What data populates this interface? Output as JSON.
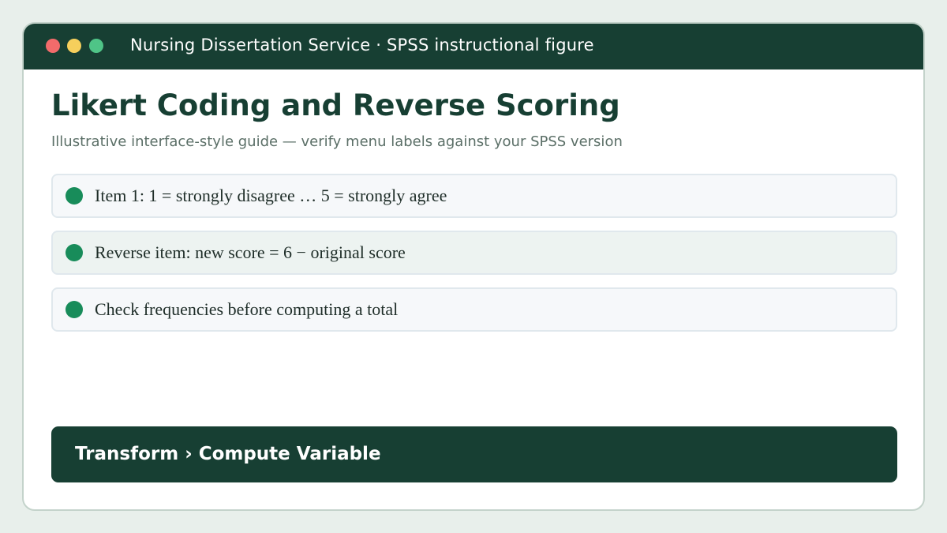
{
  "window": {
    "title": "Nursing Dissertation Service · SPSS instructional figure",
    "controls": [
      "close",
      "minimize",
      "maximize"
    ]
  },
  "main": {
    "title": "Likert Coding and Reverse Scoring",
    "subtitle": "Illustrative interface-style guide — verify menu labels against your SPSS version",
    "items": [
      {
        "text": "Item 1: 1 = strongly disagree … 5 = strongly agree"
      },
      {
        "text": "Reverse item: new score = 6 − original score"
      },
      {
        "text": "Check frequencies before computing a total"
      }
    ],
    "menu_path": "Transform › Compute Variable"
  },
  "colors": {
    "background": "#e8efeb",
    "header": "#173f33",
    "accent_dot": "#188c5a",
    "close_dot": "#f26b6b",
    "minimize_dot": "#f6cf5c",
    "maximize_dot": "#4fc487"
  }
}
